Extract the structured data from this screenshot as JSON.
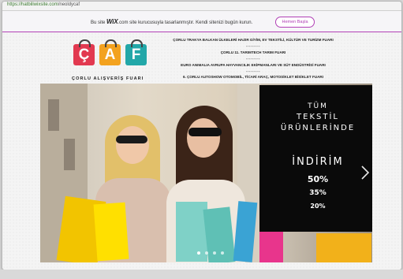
{
  "browser": {
    "url_scheme_host": "https://hatbiliwixsite.com",
    "url_path": "/neoldycaf"
  },
  "wix_banner": {
    "message_before": "Bu site",
    "wix_logo": "WiX",
    "message_after": ".com site kurucusuyla tasarlanmıştır. Kendi sitenizi bugün kurun.",
    "button_label": "Hemen Başla"
  },
  "logo": {
    "letters": [
      "Ç",
      "A",
      "F"
    ],
    "colors": [
      "#e23950",
      "#f3a21f",
      "#22a7a8"
    ],
    "tagline": "ÇORLU ALIŞVERİŞ FUARI"
  },
  "events": [
    "ÇORLU TRAKYA BALKAN ÜLKELERİ HAZIR GİYİM, EV TEKSTİLİ, KÜLTÜR VE TURİZM FUARI",
    "ÇORLU 11. TARIMTECH TARIM FUARI",
    "EURO ANIMALIA AVRUPA HAYVANCILIK EKİPMANLARI VE SÜT ENDÜSTRİSİ FUARI",
    "6. ÇORLU AUTOSHOW OTOMOBİL, TİCARİ ARAÇ, MOTOSİKLET BİSİKLET FUARI"
  ],
  "event_separator": "---------",
  "promo": {
    "line1": "TÜM",
    "line2": "TEKSTİL",
    "line3": "ÜRÜNLERİNDE",
    "line4": "İNDİRİM",
    "line5": "50%",
    "line6": "35%",
    "line7": "20%"
  },
  "slider": {
    "slide_count": 4,
    "active_slide": 1
  }
}
